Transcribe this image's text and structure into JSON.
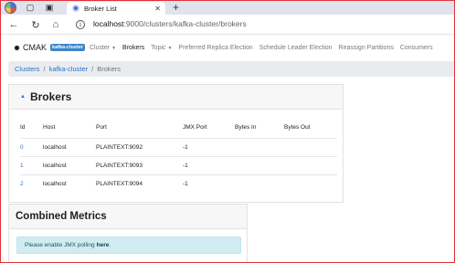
{
  "browser": {
    "tab_title": "Broker List",
    "tab_close": "✕",
    "new_tab": "+",
    "url_host": "localhost",
    "url_path": ":9000/clusters/kafka-cluster/brokers",
    "icons": [
      "browser-logo",
      "workspaces-icon",
      "tab-actions-icon",
      "back-icon",
      "reload-icon",
      "home-icon",
      "info-icon"
    ]
  },
  "navbar": {
    "brand": "CMAK",
    "cluster_badge": "kafka-cluster",
    "items": [
      {
        "label": "Cluster",
        "dropdown": true
      },
      {
        "label": "Brokers",
        "active": true
      },
      {
        "label": "Topic",
        "dropdown": true
      },
      {
        "label": "Preferred Replica Election"
      },
      {
        "label": "Schedule Leader Election"
      },
      {
        "label": "Reassign Partitions"
      },
      {
        "label": "Consumers"
      }
    ]
  },
  "breadcrumb": {
    "items": [
      "Clusters",
      "kafka-cluster"
    ],
    "current": "Brokers",
    "separator": "/"
  },
  "brokers": {
    "title": "Brokers",
    "columns": [
      "Id",
      "Host",
      "Port",
      "JMX Port",
      "Bytes In",
      "Bytes Out"
    ],
    "rows": [
      [
        "0",
        "localhost",
        "PLAINTEXT:9092",
        "-1",
        "",
        ""
      ],
      [
        "1",
        "localhost",
        "PLAINTEXT:9093",
        "-1",
        "",
        ""
      ],
      [
        "2",
        "localhost",
        "PLAINTEXT:9094",
        "-1",
        "",
        ""
      ]
    ]
  },
  "metrics": {
    "title": "Combined Metrics",
    "alert_text": "Please enable JMX polling",
    "alert_link": "here",
    "alert_end": "."
  },
  "colors": {
    "link": "#2a74c9",
    "badge": "#3a87c8",
    "alert_bg": "#d1ecf1",
    "frame_border": "#e0323a"
  }
}
